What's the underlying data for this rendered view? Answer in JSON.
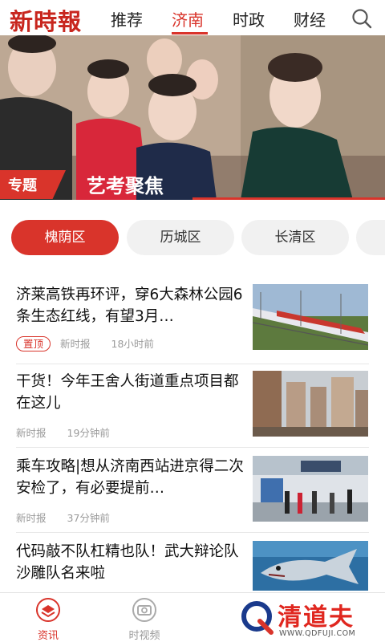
{
  "header": {
    "logo_text": "新時報",
    "tabs": [
      {
        "label": "推荐",
        "active": false
      },
      {
        "label": "济南",
        "active": true
      },
      {
        "label": "时政",
        "active": false
      },
      {
        "label": "财经",
        "active": false
      }
    ],
    "search_icon": "search-icon",
    "accent_color": "#d9342b"
  },
  "banner": {
    "topic_tag": "专题",
    "title": "艺考聚焦"
  },
  "districts": [
    {
      "label": "槐荫区",
      "active": true
    },
    {
      "label": "历城区",
      "active": false
    },
    {
      "label": "长清区",
      "active": false
    }
  ],
  "news": [
    {
      "title": "济莱高铁再环评，穿6大森林公园6条生态红线，有望3月…",
      "pinned_label": "置顶",
      "source": "新时报",
      "time": "18小时前",
      "thumb_icon": "train-photo"
    },
    {
      "title": "干货！今年王舍人街道重点项目都在这儿",
      "source": "新时报",
      "time": "19分钟前",
      "thumb_icon": "buildings-photo"
    },
    {
      "title": "乘车攻略|想从济南西站进京得二次安检了，有必要提前…",
      "source": "新时报",
      "time": "37分钟前",
      "thumb_icon": "station-photo"
    },
    {
      "title": "代码敲不队杠精也队！武大辩论队沙雕队名来啦",
      "thumb_icon": "fish-photo"
    }
  ],
  "bottom_nav": [
    {
      "label": "资讯",
      "icon": "news-icon",
      "active": true
    },
    {
      "label": "时视频",
      "icon": "camera-icon",
      "active": false
    }
  ],
  "watermark": {
    "text": "清道夫",
    "url": "WWW.QDFUJI.COM"
  }
}
